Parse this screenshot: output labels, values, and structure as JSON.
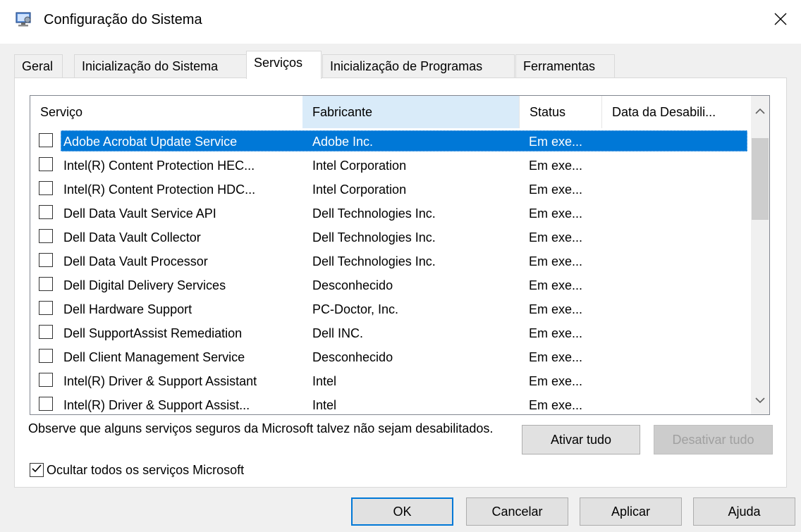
{
  "window": {
    "title": "Configuração do Sistema"
  },
  "tabs": [
    {
      "label": "Geral"
    },
    {
      "label": "Inicialização do Sistema"
    },
    {
      "label": "Serviços"
    },
    {
      "label": "Inicialização de Programas"
    },
    {
      "label": "Ferramentas"
    }
  ],
  "active_tab": "Serviços",
  "columns": {
    "service": "Serviço",
    "manufacturer": "Fabricante",
    "status": "Status",
    "date": "Data da Desabili..."
  },
  "services": [
    {
      "name": "Adobe Acrobat Update Service",
      "manufacturer": "Adobe Inc.",
      "status": "Em exe...",
      "checked": false,
      "selected": true
    },
    {
      "name": "Intel(R) Content Protection HEC...",
      "manufacturer": "Intel Corporation",
      "status": "Em exe...",
      "checked": false
    },
    {
      "name": "Intel(R) Content Protection HDC...",
      "manufacturer": "Intel Corporation",
      "status": "Em exe...",
      "checked": false
    },
    {
      "name": "Dell Data Vault Service API",
      "manufacturer": "Dell Technologies Inc.",
      "status": "Em exe...",
      "checked": false
    },
    {
      "name": "Dell Data Vault Collector",
      "manufacturer": "Dell Technologies Inc.",
      "status": "Em exe...",
      "checked": false
    },
    {
      "name": "Dell Data Vault Processor",
      "manufacturer": "Dell Technologies Inc.",
      "status": "Em exe...",
      "checked": false
    },
    {
      "name": "Dell Digital Delivery Services",
      "manufacturer": "Desconhecido",
      "status": "Em exe...",
      "checked": false
    },
    {
      "name": "Dell Hardware Support",
      "manufacturer": "PC-Doctor, Inc.",
      "status": "Em exe...",
      "checked": false
    },
    {
      "name": "Dell SupportAssist Remediation",
      "manufacturer": "Dell INC.",
      "status": "Em exe...",
      "checked": false
    },
    {
      "name": "Dell Client Management Service",
      "manufacturer": "Desconhecido",
      "status": "Em exe...",
      "checked": false
    },
    {
      "name": "Intel(R) Driver & Support Assistant",
      "manufacturer": "Intel",
      "status": "Em exe...",
      "checked": false
    },
    {
      "name": "Intel(R) Driver & Support Assist...",
      "manufacturer": "Intel",
      "status": "Em exe...",
      "checked": false
    }
  ],
  "note": "Observe que alguns serviços seguros da Microsoft talvez não sejam desabilitados.",
  "buttons": {
    "enable_all": "Ativar tudo",
    "disable_all": "Desativar tudo",
    "ok": "OK",
    "cancel": "Cancelar",
    "apply": "Aplicar",
    "help": "Ajuda"
  },
  "hide_ms": {
    "label": "Ocultar todos os serviços Microsoft",
    "checked": true
  },
  "icons": {
    "app": "system-config-icon",
    "close": "close-icon",
    "scroll_up": "scroll-up-icon",
    "scroll_down": "scroll-down-icon"
  },
  "colors": {
    "selection": "#0078d7",
    "sorted_header": "#d9ebf9",
    "default_button_border": "#0078d7"
  }
}
